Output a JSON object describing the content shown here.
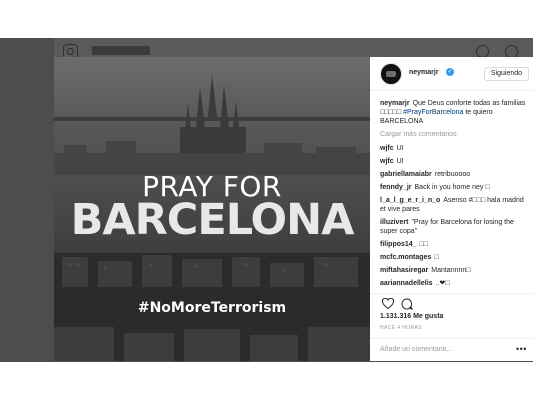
{
  "post": {
    "image": {
      "title_line1": "PRAY FOR",
      "title_line2": "BARCELONA",
      "hashtag": "#NoMoreTerrorism"
    },
    "header": {
      "username": "neymarjr",
      "verified_icon": "verified-badge-icon",
      "follow_label": "Siguiendo"
    },
    "caption": {
      "username": "neymarjr",
      "text_before_tag": "Que Deus conforte todas as familias □□□□□ ",
      "tag": "#PrayForBarcelona",
      "text_after_tag": " te quiero BARCELONA"
    },
    "load_more": "Cargar más comentarios",
    "comments": [
      {
        "user": "wjfc",
        "text": "UI"
      },
      {
        "user": "wjfc",
        "text": "UI"
      },
      {
        "user": "gabriellamaiabr",
        "text": "retribuoooo"
      },
      {
        "user": "fenndy_jr",
        "text": "Back in you home ney □"
      },
      {
        "user": "l_a_l_g_e_r_i_n_o",
        "text": "Asenso #□□□ hala madrid et vive pares"
      },
      {
        "user": "illuzivert",
        "text": "\"Pray for Barcelona for losing the super copa\""
      },
      {
        "user": "filippos14_",
        "text": "□□"
      },
      {
        "user": "mcfc.montages",
        "text": "□"
      },
      {
        "user": "miftahasiregar",
        "text": "Mantannnn□"
      },
      {
        "user": "aariannadellelis",
        "text": "..❤□"
      }
    ],
    "likes": "1.131.316 Me gusta",
    "time": "HACE 4 HORAS",
    "add_comment_placeholder": "Añade un comentario...",
    "more_options": "•••"
  },
  "colors": {
    "accent_link": "#003569",
    "verified": "#3897f0",
    "muted": "#999999",
    "backdrop": "#4d4d4d"
  },
  "icons": [
    "instagram-camera-icon",
    "compass-icon",
    "heart-outline-icon",
    "like-icon",
    "comment-icon",
    "more-options-icon"
  ]
}
